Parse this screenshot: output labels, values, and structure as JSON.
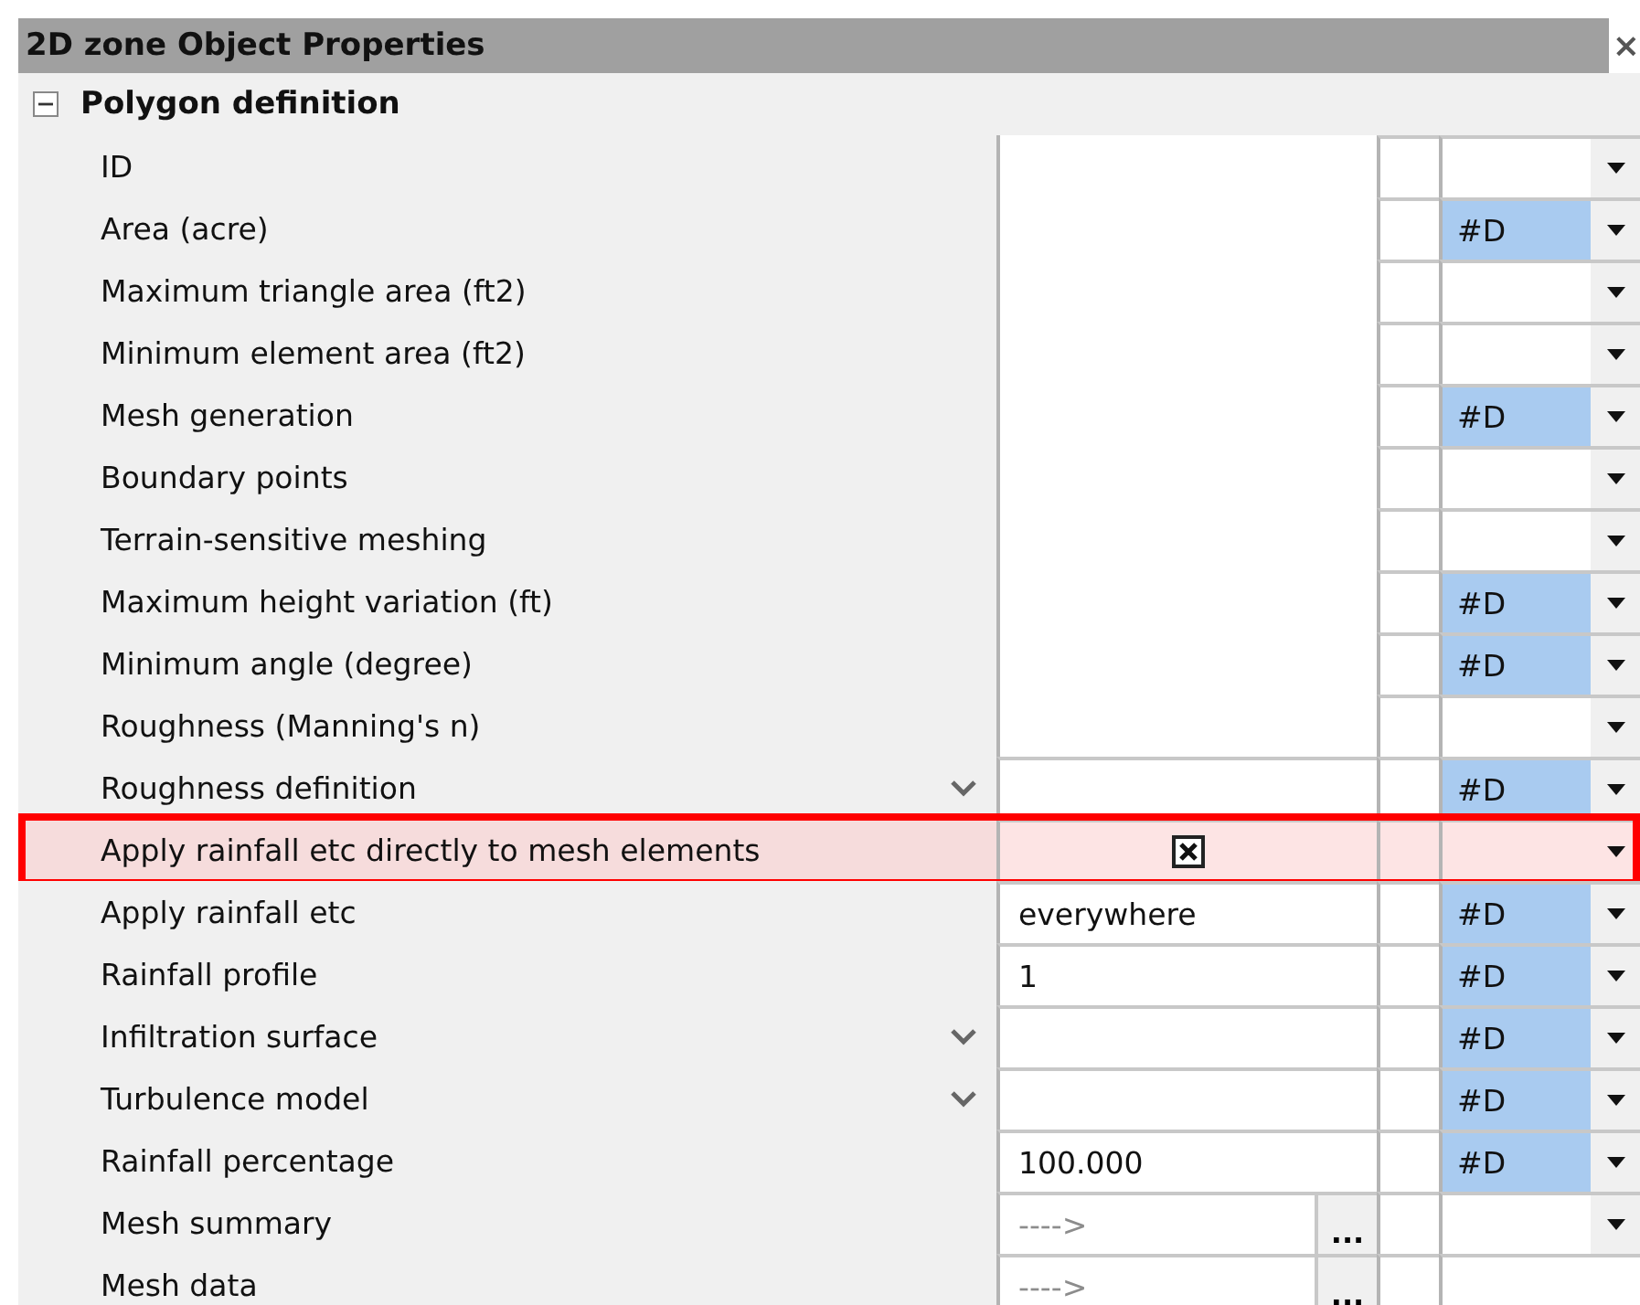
{
  "panel": {
    "title": "2D zone Object Properties",
    "close": "×"
  },
  "group": {
    "title": "Polygon definition",
    "expanded": true
  },
  "rows": [
    {
      "label": "ID",
      "kind": "blank",
      "flag": "",
      "arrow": true,
      "chevron": false,
      "highlighted": false
    },
    {
      "label": "Area (acre)",
      "kind": "blank",
      "flag": "#D",
      "arrow": true,
      "chevron": false,
      "highlighted": false
    },
    {
      "label": "Maximum triangle area (ft2)",
      "kind": "blank",
      "flag": "",
      "arrow": true,
      "chevron": false,
      "highlighted": false
    },
    {
      "label": "Minimum element area (ft2)",
      "kind": "blank",
      "flag": "",
      "arrow": true,
      "chevron": false,
      "highlighted": false
    },
    {
      "label": "Mesh generation",
      "kind": "blank",
      "flag": "#D",
      "arrow": true,
      "chevron": false,
      "highlighted": false
    },
    {
      "label": "Boundary points",
      "kind": "blank",
      "flag": "",
      "arrow": true,
      "chevron": false,
      "highlighted": false
    },
    {
      "label": "Terrain-sensitive meshing",
      "kind": "blank",
      "flag": "",
      "arrow": true,
      "chevron": false,
      "highlighted": false
    },
    {
      "label": "Maximum height variation (ft)",
      "kind": "blank",
      "flag": "#D",
      "arrow": true,
      "chevron": false,
      "highlighted": false
    },
    {
      "label": "Minimum angle (degree)",
      "kind": "blank",
      "flag": "#D",
      "arrow": true,
      "chevron": false,
      "highlighted": false
    },
    {
      "label": "Roughness (Manning's n)",
      "kind": "blank",
      "flag": "",
      "arrow": true,
      "chevron": false,
      "highlighted": false
    },
    {
      "label": "Roughness definition",
      "kind": "text",
      "value": "",
      "flag": "#D",
      "arrow": true,
      "chevron": true,
      "highlighted": false
    },
    {
      "label": "Apply rainfall etc directly to mesh elements",
      "kind": "checkbox",
      "checked": true,
      "flag": "",
      "arrow": true,
      "chevron": false,
      "highlighted": true
    },
    {
      "label": "Apply rainfall etc",
      "kind": "text",
      "value": "everywhere",
      "flag": "#D",
      "arrow": true,
      "chevron": false,
      "highlighted": false
    },
    {
      "label": "Rainfall profile",
      "kind": "text",
      "value": "1",
      "flag": "#D",
      "arrow": true,
      "chevron": false,
      "highlighted": false
    },
    {
      "label": "Infiltration surface",
      "kind": "text",
      "value": "",
      "flag": "#D",
      "arrow": true,
      "chevron": true,
      "highlighted": false
    },
    {
      "label": "Turbulence model",
      "kind": "text",
      "value": "",
      "flag": "#D",
      "arrow": true,
      "chevron": true,
      "highlighted": false
    },
    {
      "label": "Rainfall percentage",
      "kind": "text",
      "value": "100.000",
      "flag": "#D",
      "arrow": true,
      "chevron": false,
      "highlighted": false
    },
    {
      "label": "Mesh summary",
      "kind": "link",
      "value": "---->",
      "button": "...",
      "flag": "",
      "arrow": true,
      "chevron": false,
      "highlighted": false
    },
    {
      "label": "Mesh data",
      "kind": "link",
      "value": "---->",
      "button": "...",
      "flag": "",
      "arrow": false,
      "chevron": false,
      "highlighted": false
    }
  ]
}
